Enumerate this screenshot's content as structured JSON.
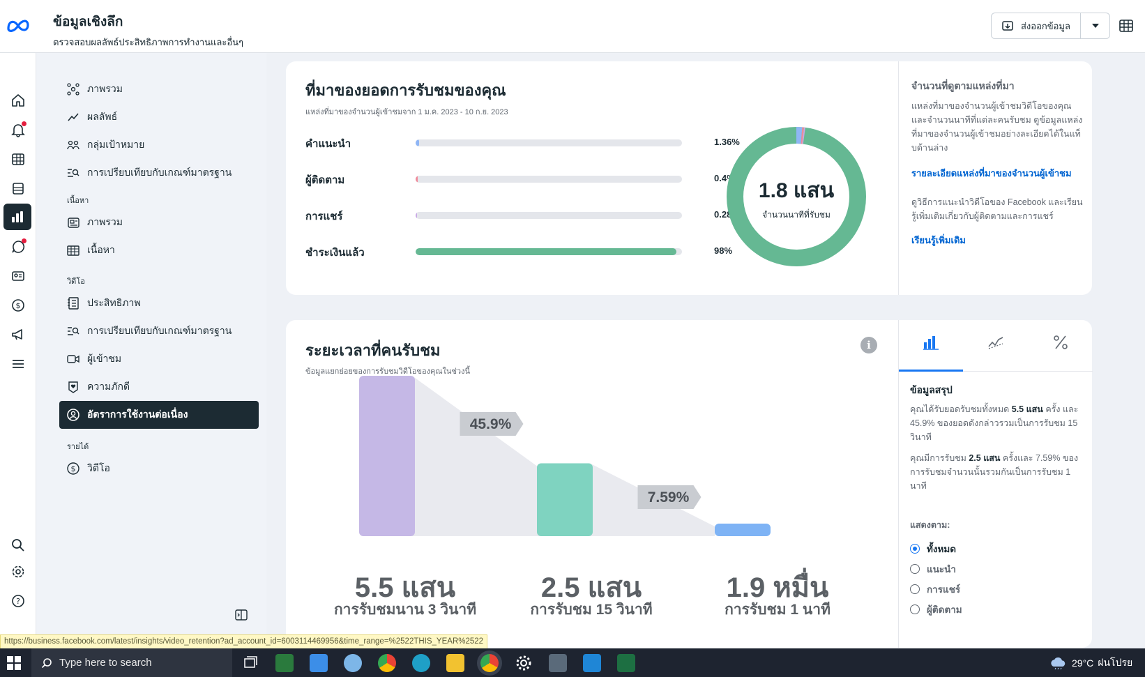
{
  "header": {
    "title": "ข้อมูลเชิงลึก",
    "subtitle": "ตรวจสอบผลลัพธ์ประสิทธิภาพการทำงานและอื่นๆ",
    "export_label": "ส่งออกข้อมูล"
  },
  "sidebar": {
    "items_top": [
      {
        "label": "ภาพรวม",
        "icon": "network-icon"
      },
      {
        "label": "ผลลัพธ์",
        "icon": "trend-icon"
      },
      {
        "label": "กลุ่มเป้าหมาย",
        "icon": "people-icon"
      },
      {
        "label": "การเปรียบเทียบกับเกณฑ์มาตรฐาน",
        "icon": "benchmark-icon"
      }
    ],
    "section_content": "เนื้อหา",
    "items_content": [
      {
        "label": "ภาพรวม",
        "icon": "content-overview-icon"
      },
      {
        "label": "เนื้อหา",
        "icon": "table-icon"
      }
    ],
    "section_video": "วิดีโอ",
    "items_video": [
      {
        "label": "ประสิทธิภาพ",
        "icon": "notebook-icon"
      },
      {
        "label": "การเปรียบเทียบกับเกณฑ์มาตรฐาน",
        "icon": "benchmark-icon"
      },
      {
        "label": "ผู้เข้าชม",
        "icon": "video-camera-icon"
      },
      {
        "label": "ความภักดี",
        "icon": "heart-badge-icon"
      },
      {
        "label": "อัตราการใช้งานต่อเนื่อง",
        "icon": "user-circle-icon",
        "active": true
      }
    ],
    "section_income": "รายได้",
    "items_income": [
      {
        "label": "วิดีโอ",
        "icon": "dollar-icon"
      }
    ]
  },
  "sources": {
    "title": "ที่มาของยอดการรับชมของคุณ",
    "subtitle": "แหล่งที่มาของจำนวนผู้เข้าชมจาก 1 ม.ค. 2023 - 10 ก.ย. 2023",
    "rows": [
      {
        "label": "คำแนะนำ",
        "value": "1.36%"
      },
      {
        "label": "ผู้ติดตาม",
        "value": "0.4%"
      },
      {
        "label": "การแชร์",
        "value": "0.28%"
      },
      {
        "label": "ชำระเงินแล้ว",
        "value": "98%"
      }
    ],
    "donut_value": "1.8 แสน",
    "donut_label": "จำนวนนาทีที่รับชม",
    "colors": {
      "recommend": "#8fb6f5",
      "followers": "#f08a9a",
      "shares": "#c9a9e6",
      "paid": "#65b893",
      "track": "#e4e6eb"
    }
  },
  "sources_panel": {
    "title": "จำนวนที่ดูตามแหล่งที่มา",
    "text": "แหล่งที่มาของจำนวนผู้เข้าชมวิดีโอของคุณและจำนวนนาทีที่แต่ละคนรับชม ดูข้อมูลแหล่งที่มาของจำนวนผู้เข้าชมอย่างละเอียดได้ในแท็บด้านล่าง",
    "link1": "รายละเอียดแหล่งที่มาของจำนวนผู้เข้าชม",
    "text2": "ดูวิธีการแนะนำวิดีโอของ Facebook และเรียนรู้เพิ่มเติมเกี่ยวกับผู้ติดตามและการแชร์",
    "link2": "เรียนรู้เพิ่มเติม"
  },
  "retention": {
    "title": "ระยะเวลาที่คนรับชม",
    "subtitle": "ข้อมูลแยกย่อยของการรับชมวิดีโอของคุณในช่วงนี้",
    "drop_labels": [
      "45.9%",
      "7.59%"
    ],
    "stages": [
      {
        "value": "5.5 แสน",
        "label": "การรับชมนาน 3 วินาที"
      },
      {
        "value": "2.5 แสน",
        "label": "การรับชม 15 วินาที"
      },
      {
        "value": "1.9 หมื่น",
        "label": "การรับชม 1 นาที"
      }
    ],
    "bar_colors": [
      "#c5b8e6",
      "#7fd3c0",
      "#7eb3f5"
    ]
  },
  "chart_data": {
    "type": "bar",
    "title": "ระยะเวลาที่คนรับชม",
    "categories": [
      "การรับชมนาน 3 วินาที",
      "การรับชม 15 วินาที",
      "การรับชม 1 นาที"
    ],
    "values": [
      550000,
      250000,
      19000
    ],
    "annotations": [
      "45.9%",
      "7.59%"
    ]
  },
  "summary": {
    "title": "ข้อมูลสรุป",
    "p1_a": "คุณได้รับยอดรับชมทั้งหมด ",
    "p1_b": "5.5 แสน",
    "p1_c": " ครั้ง และ 45.9% ของยอดดังกล่าวรวมเป็นการรับชม 15 วินาที",
    "p2_a": "คุณมีการรับชม ",
    "p2_b": "2.5 แสน",
    "p2_c": " ครั้งและ 7.59% ของการรับชมจำนวนนั้นรวมกันเป็นการรับชม 1 นาที",
    "show_by": "แสดงตาม:",
    "options": [
      "ทั้งหมด",
      "แนะนำ",
      "การแชร์",
      "ผู้ติดตาม"
    ],
    "selected": 0
  },
  "status_url": "https://business.facebook.com/latest/insights/video_retention?ad_account_id=6003114469956&time_range=%2522THIS_YEAR%2522",
  "taskbar": {
    "search_placeholder": "Type here to search",
    "weather": "29°C",
    "weather_text": "ฝนโปรย"
  }
}
